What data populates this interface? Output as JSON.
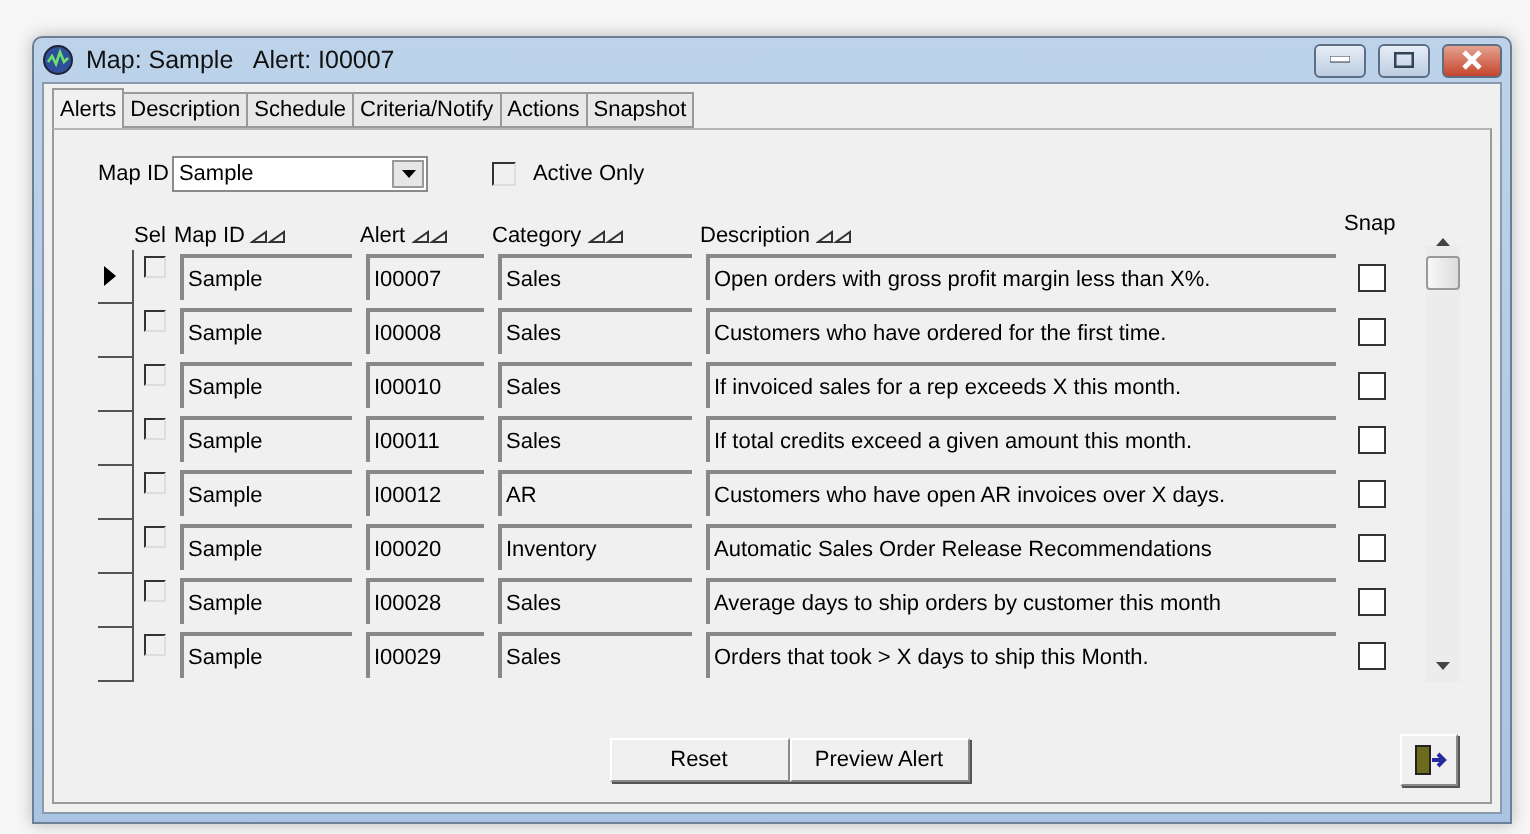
{
  "window": {
    "title": "Map: Sample   Alert: I00007"
  },
  "tabs": [
    {
      "label": "Alerts",
      "selected": true
    },
    {
      "label": "Description",
      "selected": false
    },
    {
      "label": "Schedule",
      "selected": false
    },
    {
      "label": "Criteria/Notify",
      "selected": false
    },
    {
      "label": "Actions",
      "selected": false
    },
    {
      "label": "Snapshot",
      "selected": false
    }
  ],
  "filter": {
    "map_id_label": "Map ID",
    "map_id_value": "Sample",
    "active_only": {
      "label": "Active Only",
      "checked": false
    }
  },
  "table": {
    "columns": [
      {
        "label": "Sel",
        "sortable": false
      },
      {
        "label": "Map ID",
        "sortable": true
      },
      {
        "label": "Alert",
        "sortable": true
      },
      {
        "label": "Category",
        "sortable": true
      },
      {
        "label": "Description",
        "sortable": true
      },
      {
        "label": "Snap",
        "sortable": false
      }
    ],
    "rows": [
      {
        "current": true,
        "sel": false,
        "map_id": "Sample",
        "alert": "I00007",
        "category": "Sales",
        "description": "Open orders with gross profit margin less than X%.",
        "snap": false
      },
      {
        "current": false,
        "sel": false,
        "map_id": "Sample",
        "alert": "I00008",
        "category": "Sales",
        "description": "Customers who have ordered for the first time.",
        "snap": false
      },
      {
        "current": false,
        "sel": false,
        "map_id": "Sample",
        "alert": "I00010",
        "category": "Sales",
        "description": "If invoiced sales for a rep exceeds X this month.",
        "snap": false
      },
      {
        "current": false,
        "sel": false,
        "map_id": "Sample",
        "alert": "I00011",
        "category": "Sales",
        "description": "If total credits exceed a given amount this month.",
        "snap": false
      },
      {
        "current": false,
        "sel": false,
        "map_id": "Sample",
        "alert": "I00012",
        "category": "AR",
        "description": "Customers who have open AR invoices over X days.",
        "snap": false
      },
      {
        "current": false,
        "sel": false,
        "map_id": "Sample",
        "alert": "I00020",
        "category": "Inventory",
        "description": "Automatic Sales Order Release Recommendations",
        "snap": false
      },
      {
        "current": false,
        "sel": false,
        "map_id": "Sample",
        "alert": "I00028",
        "category": "Sales",
        "description": "Average days to ship orders by customer this month",
        "snap": false
      },
      {
        "current": false,
        "sel": false,
        "map_id": "Sample",
        "alert": "I00029",
        "category": "Sales",
        "description": "Orders that took > X days to ship this Month.",
        "snap": false
      }
    ]
  },
  "buttons": [
    {
      "label": "Reset"
    },
    {
      "label": "Preview Alert"
    }
  ]
}
